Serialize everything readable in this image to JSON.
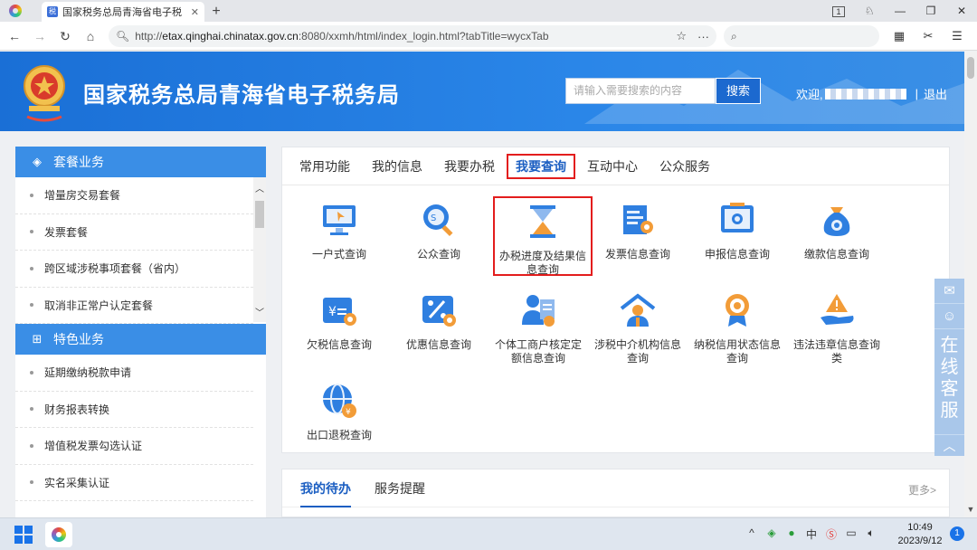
{
  "browser": {
    "tab_title": "国家税务总局青海省电子税",
    "tab_favicon": "税",
    "url_prefix": "http://",
    "url_host": "etax.qinghai.chinatax.gov.cn",
    "url_rest": ":8080/xxmh/html/index_login.html?tabTitle=wycxTab",
    "tab_count_badge": "1"
  },
  "site": {
    "title": "国家税务总局青海省电子税务局",
    "search_placeholder": "请输入需要搜索的内容",
    "search_button": "搜索",
    "welcome": "欢迎,",
    "separator": "|",
    "logout": "退出"
  },
  "sidebar": {
    "group1": {
      "title": "套餐业务",
      "items": [
        "增量房交易套餐",
        "发票套餐",
        "跨区域涉税事项套餐（省内）",
        "取消非正常户认定套餐"
      ]
    },
    "group2": {
      "title": "特色业务",
      "items": [
        "延期缴纳税款申请",
        "财务报表转换",
        "增值税发票勾选认证",
        "实名采集认证"
      ]
    }
  },
  "main": {
    "tabs": [
      "常用功能",
      "我的信息",
      "我要办税",
      "我要查询",
      "互动中心",
      "公众服务"
    ],
    "active_tab": "我要查询",
    "items": [
      {
        "label": "一户式查询",
        "icon": "monitor-icon"
      },
      {
        "label": "公众查询",
        "icon": "search-globe-icon"
      },
      {
        "label": "办税进度及结果信息查询",
        "icon": "hourglass-icon"
      },
      {
        "label": "发票信息查询",
        "icon": "invoice-icon"
      },
      {
        "label": "申报信息查询",
        "icon": "declaration-icon"
      },
      {
        "label": "缴款信息查询",
        "icon": "money-bag-icon"
      },
      {
        "label": "欠税信息查询",
        "icon": "arrears-icon"
      },
      {
        "label": "优惠信息查询",
        "icon": "discount-icon"
      },
      {
        "label": "个体工商户核定定额信息查询",
        "icon": "person-document-icon"
      },
      {
        "label": "涉税中介机构信息查询",
        "icon": "agency-house-icon"
      },
      {
        "label": "纳税信用状态信息查询",
        "icon": "credit-medal-icon"
      },
      {
        "label": "违法违章信息查询类",
        "icon": "warning-hand-icon"
      },
      {
        "label": "出口退税查询",
        "icon": "export-globe-icon"
      }
    ]
  },
  "todo": {
    "tabs": [
      "我的待办",
      "服务提醒"
    ],
    "more": "更多>"
  },
  "float_service": {
    "label_chars": [
      "在",
      "线",
      "客",
      "服"
    ]
  },
  "taskbar": {
    "time": "10:49",
    "date": "2023/9/12",
    "notif_count": "1"
  },
  "colors": {
    "brand_blue": "#1a6fd6",
    "highlight_red": "#e31d1d",
    "sidebar_head": "#3a8ee6"
  }
}
